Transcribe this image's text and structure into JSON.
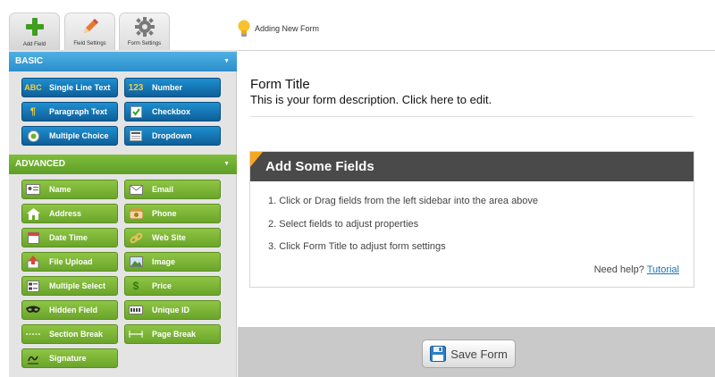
{
  "tabs": [
    {
      "label": "Add Field",
      "icon": "plus-icon",
      "active": true
    },
    {
      "label": "Field Settings",
      "icon": "pencil-icon",
      "active": false
    },
    {
      "label": "Form Settings",
      "icon": "gear-icon",
      "active": false
    }
  ],
  "status": {
    "text": "Adding New Form",
    "icon": "lightbulb-icon"
  },
  "sidebar": {
    "basic": {
      "title": "BASIC",
      "items": [
        {
          "label": "Single Line Text",
          "icon": "abc-text-icon"
        },
        {
          "label": "Number",
          "icon": "number-123-icon"
        },
        {
          "label": "Paragraph Text",
          "icon": "paragraph-icon"
        },
        {
          "label": "Checkbox",
          "icon": "checkbox-icon"
        },
        {
          "label": "Multiple Choice",
          "icon": "radio-icon"
        },
        {
          "label": "Dropdown",
          "icon": "dropdown-icon"
        }
      ]
    },
    "advanced": {
      "title": "ADVANCED",
      "items": [
        {
          "label": "Name",
          "icon": "name-card-icon"
        },
        {
          "label": "Email",
          "icon": "envelope-icon"
        },
        {
          "label": "Address",
          "icon": "house-icon"
        },
        {
          "label": "Phone",
          "icon": "phone-icon"
        },
        {
          "label": "Date Time",
          "icon": "calendar-icon"
        },
        {
          "label": "Web Site",
          "icon": "link-icon"
        },
        {
          "label": "File Upload",
          "icon": "upload-icon"
        },
        {
          "label": "Image",
          "icon": "image-icon"
        },
        {
          "label": "Multiple Select",
          "icon": "multi-select-icon"
        },
        {
          "label": "Price",
          "icon": "dollar-icon"
        },
        {
          "label": "Hidden Field",
          "icon": "mask-icon"
        },
        {
          "label": "Unique ID",
          "icon": "id-icon"
        },
        {
          "label": "Section Break",
          "icon": "section-break-icon"
        },
        {
          "label": "Page Break",
          "icon": "page-break-icon"
        },
        {
          "label": "Signature",
          "icon": "signature-icon"
        }
      ]
    }
  },
  "main": {
    "form_title": "Form Title",
    "form_description": "This is your form description. Click here to edit.",
    "fields_box": {
      "title": "Add Some Fields",
      "steps": [
        "1. Click or Drag fields from the left sidebar into the area above",
        "2. Select fields to adjust properties",
        "3. Click Form Title to adjust form settings"
      ],
      "help_text": "Need help?",
      "help_link": "Tutorial"
    }
  },
  "footer": {
    "save_label": "Save Form",
    "save_icon": "floppy-disk-icon"
  },
  "colors": {
    "basic": "#2b8fcc",
    "advanced": "#6aa52a",
    "accent_orange": "#f5a623",
    "banner": "#4a4a4a",
    "link": "#1b74b8"
  }
}
